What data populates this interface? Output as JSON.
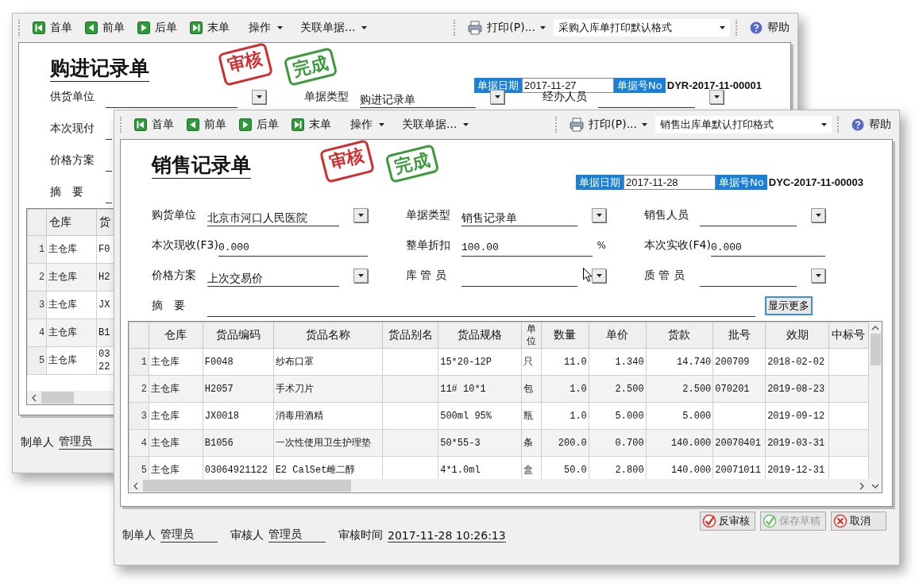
{
  "windows": [
    {
      "toolbar": {
        "nav": [
          {
            "kind": "first",
            "label": "首单"
          },
          {
            "kind": "prev",
            "label": "前单"
          },
          {
            "kind": "next",
            "label": "后单"
          },
          {
            "kind": "last",
            "label": "末单"
          }
        ],
        "menus": [
          "操作",
          "关联单据..."
        ],
        "print": "打印(P)...",
        "print_format": "采购入库单打印默认格式",
        "help": "帮助"
      },
      "title": "购进记录单",
      "stamps": [
        {
          "text": "审核",
          "color": "#d22c2c"
        },
        {
          "text": "完成",
          "color": "#3c9a3c"
        }
      ],
      "date_label": "单据日期",
      "date": "2017-11-27",
      "number_label": "单据号No",
      "number": "DYR-2017-11-00001",
      "form_rows": [
        [
          {
            "label": "供货单位",
            "kind": "combo"
          },
          {
            "label": "单据类型",
            "value": "购进记录单",
            "kind": "combo"
          },
          {
            "label": "经办人员",
            "kind": "combo"
          }
        ],
        [
          {
            "label": "本次现付",
            "kind": "text"
          }
        ],
        [
          {
            "label": "价格方案",
            "kind": "text"
          }
        ],
        [
          {
            "label": "摘　要",
            "kind": "memo"
          }
        ]
      ],
      "table": {
        "columns": [
          "仓库",
          "货"
        ],
        "rows": [
          {
            "no": "1",
            "cells": [
              "主仓库",
              "F0"
            ]
          },
          {
            "no": "2",
            "cells": [
              "主仓库",
              "H2"
            ]
          },
          {
            "no": "3",
            "cells": [
              "主仓库",
              "JX"
            ]
          },
          {
            "no": "4",
            "cells": [
              "主仓库",
              "B1"
            ]
          },
          {
            "no": "5",
            "cells": [
              "主仓库",
              "03\n22"
            ]
          }
        ]
      },
      "footer": {
        "fields": [
          {
            "label": "制单人",
            "value": "管理员"
          }
        ]
      }
    },
    {
      "toolbar": {
        "nav": [
          {
            "kind": "first",
            "label": "首单"
          },
          {
            "kind": "prev",
            "label": "前单"
          },
          {
            "kind": "next",
            "label": "后单"
          },
          {
            "kind": "last",
            "label": "末单"
          }
        ],
        "menus": [
          "操作",
          "关联单据..."
        ],
        "print": "打印(P)...",
        "print_format": "销售出库单默认打印格式",
        "help": "帮助"
      },
      "title": "销售记录单",
      "stamps": [
        {
          "text": "审核",
          "color": "#d22c2c"
        },
        {
          "text": "完成",
          "color": "#3c9a3c"
        }
      ],
      "date_label": "单据日期",
      "date": "2017-11-28",
      "number_label": "单据号No",
      "number": "DYC-2017-11-00003",
      "form_rows": [
        [
          {
            "label": "购货单位",
            "value": "北京市河口人民医院",
            "kind": "combo"
          },
          {
            "label": "单据类型",
            "value": "销售记录单",
            "kind": "combo"
          },
          {
            "label": "销售人员",
            "kind": "combo"
          }
        ],
        [
          {
            "label": "本次现收(F3)",
            "value": "0.000",
            "kind": "text"
          },
          {
            "label": "整单折扣",
            "value": "100.00",
            "kind": "text",
            "suffix": "%"
          },
          {
            "label": "本次实收(F4)",
            "value": "0.000",
            "kind": "text"
          }
        ],
        [
          {
            "label": "价格方案",
            "value": "上次交易价",
            "kind": "combo"
          },
          {
            "label": "库 管 员",
            "kind": "combo"
          },
          {
            "label": "质 管 员",
            "kind": "combo"
          }
        ],
        [
          {
            "label": "摘　要",
            "kind": "memo",
            "button": "显示更多"
          }
        ]
      ],
      "table": {
        "columns": [
          "仓库",
          "货品编码",
          "货品名称",
          "货品别名",
          "货品规格",
          "单位",
          "数量",
          "单价",
          "货款",
          "批号",
          "效期",
          "中标号"
        ],
        "rows": [
          {
            "no": "1",
            "cells": [
              "主仓库",
              "F0048",
              "纱布口罩",
              null,
              "15*20-12P",
              "只",
              "11.0",
              "1.340",
              "14.740",
              "200709",
              "2018-02-02",
              null
            ]
          },
          {
            "no": "2",
            "cells": [
              "主仓库",
              "H2057",
              "手术刀片",
              null,
              "11# 10*1",
              "包",
              "1.0",
              "2.500",
              "2.500",
              "070201",
              "2019-08-23",
              null
            ]
          },
          {
            "no": "3",
            "cells": [
              "主仓库",
              "JX0018",
              "消毒用酒精",
              null,
              "500ml 95%",
              "瓶",
              "1.0",
              "5.000",
              "5.000",
              null,
              "2019-09-12",
              null
            ]
          },
          {
            "no": "4",
            "cells": [
              "主仓库",
              "B1056",
              "一次性使用卫生护理垫",
              null,
              "50*55-3",
              "条",
              "200.0",
              "0.700",
              "140.000",
              "20070401",
              "2019-03-31",
              null
            ]
          },
          {
            "no": "5",
            "cells": [
              "主仓库",
              "03064921122",
              "E2 CalSet雌二醇",
              null,
              "4*1.0ml",
              "盒",
              "50.0",
              "2.800",
              "140.000",
              "20071011",
              "2019-12-31",
              null
            ]
          }
        ]
      },
      "footer": {
        "fields": [
          {
            "label": "制单人",
            "value": "管理员"
          },
          {
            "label": "审核人",
            "value": "管理员"
          },
          {
            "label": "审核时间",
            "value": "2017-11-28 10:26:13"
          }
        ],
        "buttons": [
          {
            "label": "反审核",
            "kind": "confirm",
            "disabled": false
          },
          {
            "label": "保存草稿",
            "kind": "confirm",
            "disabled": true
          },
          {
            "label": "取消",
            "kind": "cancel",
            "disabled": false
          }
        ]
      }
    }
  ]
}
